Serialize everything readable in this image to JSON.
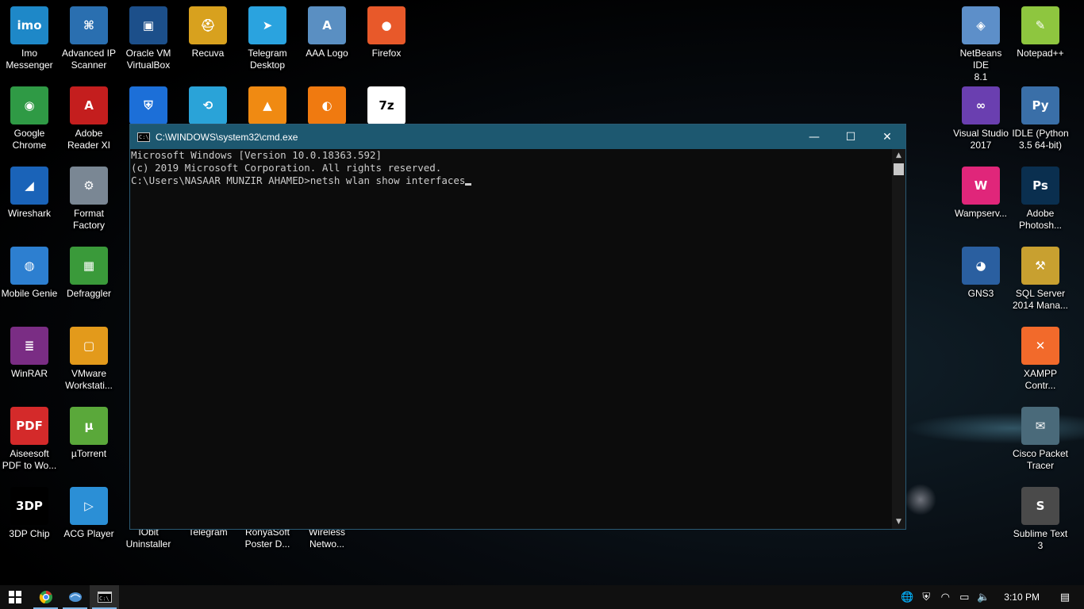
{
  "desktop_icons_left": [
    {
      "label": "Imo\nMessenger",
      "name": "imo-messenger",
      "color": "#1e88c8",
      "glyph": "imo"
    },
    {
      "label": "Advanced IP\nScanner",
      "name": "advanced-ip-scanner",
      "color": "#2a6fb0",
      "glyph": "⌘"
    },
    {
      "label": "Oracle VM\nVirtualBox",
      "name": "virtualbox",
      "color": "#1c4f8a",
      "glyph": "▣"
    },
    {
      "label": "Recuva",
      "name": "recuva",
      "color": "#d8a11e",
      "glyph": "⛑"
    },
    {
      "label": "Telegram\nDesktop",
      "name": "telegram-desktop",
      "color": "#2aa3df",
      "glyph": "➤"
    },
    {
      "label": "AAA Logo",
      "name": "aaa-logo",
      "color": "#5a8fc2",
      "glyph": "A"
    },
    {
      "label": "Firefox",
      "name": "firefox",
      "color": "#e8592a",
      "glyph": "●"
    },
    {
      "label": "Google\nChrome",
      "name": "google-chrome",
      "color": "#2f9a45",
      "glyph": "◉"
    },
    {
      "label": "Adobe\nReader XI",
      "name": "adobe-reader",
      "color": "#c41e1e",
      "glyph": "A"
    },
    {
      "label": "Wireshark",
      "name": "wireshark",
      "color": "#1a63b8",
      "glyph": "◢"
    },
    {
      "label": "Format\nFactory",
      "name": "format-factory",
      "color": "#7a8794",
      "glyph": "⚙"
    },
    {
      "label": "Mobile Genie",
      "name": "mobile-genie",
      "color": "#2d7fd0",
      "glyph": "◍"
    },
    {
      "label": "Defraggler",
      "name": "defraggler",
      "color": "#3a9a3a",
      "glyph": "▦"
    },
    {
      "label": "WinRAR",
      "name": "winrar",
      "color": "#7a2d84",
      "glyph": "≣"
    },
    {
      "label": "VMware\nWorkstati...",
      "name": "vmware-workstation",
      "color": "#e39a1b",
      "glyph": "▢"
    },
    {
      "label": "Aiseesoft\nPDF to Wo...",
      "name": "aiseesoft-pdf",
      "color": "#d42a2a",
      "glyph": "PDF"
    },
    {
      "label": "µTorrent",
      "name": "utorrent",
      "color": "#5aa83a",
      "glyph": "µ"
    },
    {
      "label": "3DP Chip",
      "name": "3dp-chip",
      "color": "#000000",
      "glyph": "3DP"
    },
    {
      "label": "ACG Player",
      "name": "acg-player",
      "color": "#2b8fd6",
      "glyph": "▷"
    }
  ],
  "desktop_icons_row2_hidden": [
    {
      "name": "bitdefender",
      "color": "#1c6fd8",
      "glyph": "⛨"
    },
    {
      "name": "shareit",
      "color": "#2aa3d8",
      "glyph": "⟲"
    },
    {
      "name": "vlc",
      "color": "#f08a12",
      "glyph": "▲"
    },
    {
      "name": "ashampoo",
      "color": "#f07a10",
      "glyph": "◐"
    },
    {
      "name": "7zip",
      "color": "#ffffff",
      "glyph": "7z"
    }
  ],
  "desktop_icons_bottom_partial": [
    {
      "label": "IObit\nUninstaller",
      "name": "iobit-uninstaller"
    },
    {
      "label": "Telegram",
      "name": "telegram"
    },
    {
      "label": "RonyaSoft\nPoster D...",
      "name": "ronyasoft-poster"
    },
    {
      "label": "Wireless\nNetwo...",
      "name": "wireless-network"
    }
  ],
  "desktop_icons_right": [
    {
      "label": "NetBeans IDE\n8.1",
      "name": "netbeans",
      "color": "#5d8fc9",
      "glyph": "◈"
    },
    {
      "label": "Notepad++",
      "name": "notepad-plus-plus",
      "color": "#8ec63f",
      "glyph": "✎"
    },
    {
      "label": "Visual Studio\n2017",
      "name": "visual-studio",
      "color": "#6a3fb0",
      "glyph": "∞"
    },
    {
      "label": "IDLE (Python\n3.5 64-bit)",
      "name": "idle-python",
      "color": "#3a6fa8",
      "glyph": "Py"
    },
    {
      "label": "Wampserv...",
      "name": "wampserver",
      "color": "#e0267a",
      "glyph": "W"
    },
    {
      "label": "Adobe\nPhotosh...",
      "name": "adobe-photoshop",
      "color": "#0a2f4f",
      "glyph": "Ps"
    },
    {
      "label": "GNS3",
      "name": "gns3",
      "color": "#2a5fa0",
      "glyph": "◕"
    },
    {
      "label": "SQL Server\n2014 Mana...",
      "name": "sql-server",
      "color": "#c8a030",
      "glyph": "⚒"
    },
    {
      "label": "XAMPP\nContr...",
      "name": "xampp",
      "color": "#f26a2b",
      "glyph": "✕"
    },
    {
      "label": "Cisco Packet\nTracer",
      "name": "cisco-packet-tracer",
      "color": "#4a6a7a",
      "glyph": "✉"
    },
    {
      "label": "Sublime Text\n3",
      "name": "sublime-text",
      "color": "#4a4a4a",
      "glyph": "S"
    }
  ],
  "cmd": {
    "title": "C:\\WINDOWS\\system32\\cmd.exe",
    "icon_text": "C:\\",
    "minimize": "—",
    "maximize": "☐",
    "close": "✕",
    "lines": [
      "Microsoft Windows [Version 10.0.18363.592]",
      "(c) 2019 Microsoft Corporation. All rights reserved.",
      "",
      "C:\\Users\\NASAAR MUNZIR AHAMED>netsh wlan show interfaces"
    ],
    "scroll_up": "▲",
    "scroll_down": "▼"
  },
  "taskbar": {
    "clock": "3:10 PM",
    "tray_icons": [
      "network-globe-icon",
      "security-shield-icon",
      "wifi-icon",
      "power-icon",
      "volume-icon"
    ],
    "tray_glyphs": [
      "🌐",
      "⛨",
      "◠",
      "▭",
      "🔈"
    ],
    "notification": "▤"
  }
}
